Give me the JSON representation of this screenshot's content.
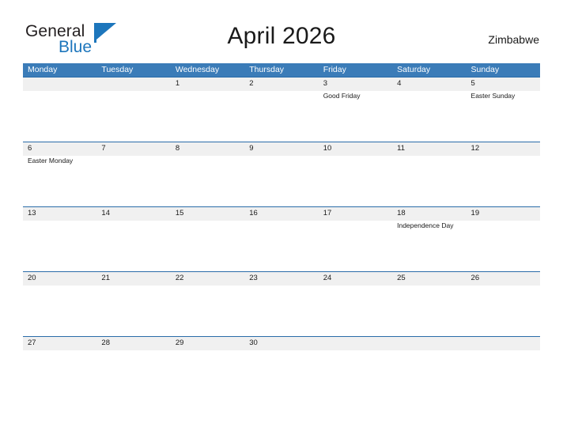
{
  "brand": {
    "name_part1": "General",
    "name_part2": "Blue",
    "flag_icon": "flag-triangle-icon",
    "accent_color": "#1d76bc"
  },
  "header": {
    "title": "April 2026",
    "country": "Zimbabwe"
  },
  "calendar": {
    "header_bg": "#3b7cb8",
    "band_bg": "#f0f0f0",
    "row_border": "#2a6ca8",
    "weekdays": [
      "Monday",
      "Tuesday",
      "Wednesday",
      "Thursday",
      "Friday",
      "Saturday",
      "Sunday"
    ],
    "weeks": [
      [
        {
          "day": "",
          "event": ""
        },
        {
          "day": "",
          "event": ""
        },
        {
          "day": "1",
          "event": ""
        },
        {
          "day": "2",
          "event": ""
        },
        {
          "day": "3",
          "event": "Good Friday"
        },
        {
          "day": "4",
          "event": ""
        },
        {
          "day": "5",
          "event": "Easter Sunday"
        }
      ],
      [
        {
          "day": "6",
          "event": "Easter Monday"
        },
        {
          "day": "7",
          "event": ""
        },
        {
          "day": "8",
          "event": ""
        },
        {
          "day": "9",
          "event": ""
        },
        {
          "day": "10",
          "event": ""
        },
        {
          "day": "11",
          "event": ""
        },
        {
          "day": "12",
          "event": ""
        }
      ],
      [
        {
          "day": "13",
          "event": ""
        },
        {
          "day": "14",
          "event": ""
        },
        {
          "day": "15",
          "event": ""
        },
        {
          "day": "16",
          "event": ""
        },
        {
          "day": "17",
          "event": ""
        },
        {
          "day": "18",
          "event": "Independence Day"
        },
        {
          "day": "19",
          "event": ""
        }
      ],
      [
        {
          "day": "20",
          "event": ""
        },
        {
          "day": "21",
          "event": ""
        },
        {
          "day": "22",
          "event": ""
        },
        {
          "day": "23",
          "event": ""
        },
        {
          "day": "24",
          "event": ""
        },
        {
          "day": "25",
          "event": ""
        },
        {
          "day": "26",
          "event": ""
        }
      ],
      [
        {
          "day": "27",
          "event": ""
        },
        {
          "day": "28",
          "event": ""
        },
        {
          "day": "29",
          "event": ""
        },
        {
          "day": "30",
          "event": ""
        },
        {
          "day": "",
          "event": ""
        },
        {
          "day": "",
          "event": ""
        },
        {
          "day": "",
          "event": ""
        }
      ]
    ]
  }
}
